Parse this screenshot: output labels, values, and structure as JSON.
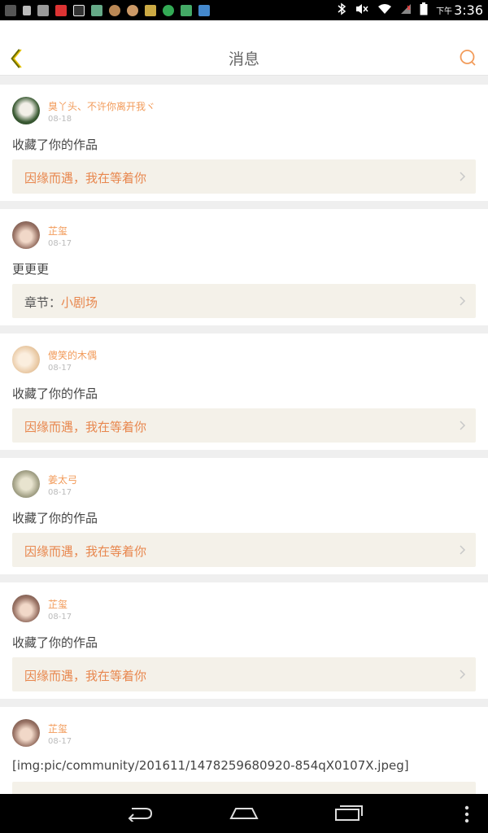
{
  "status_bar": {
    "time_prefix": "下午",
    "time": "3:36"
  },
  "header": {
    "title": "消息"
  },
  "messages": [
    {
      "user": "臭丫头、不许你离开我ヾ",
      "date": "08-18",
      "action": "收藏了你的作品",
      "ref_prefix": "",
      "ref_title": "因缘而遇，我在等着你"
    },
    {
      "user": "芷玺",
      "date": "08-17",
      "action": "更更更",
      "ref_prefix": "章节：",
      "ref_title": "小剧场"
    },
    {
      "user": "傻笑的木偶",
      "date": "08-17",
      "action": "收藏了你的作品",
      "ref_prefix": "",
      "ref_title": "因缘而遇，我在等着你"
    },
    {
      "user": "姜太弓",
      "date": "08-17",
      "action": "收藏了你的作品",
      "ref_prefix": "",
      "ref_title": "因缘而遇，我在等着你"
    },
    {
      "user": "芷玺",
      "date": "08-17",
      "action": "收藏了你的作品",
      "ref_prefix": "",
      "ref_title": "因缘而遇，我在等着你"
    },
    {
      "user": "芷玺",
      "date": "08-17",
      "action": "[img:pic/community/201611/1478259680920-854qX0107X.jpeg]",
      "ref_prefix": "",
      "ref_title": ""
    }
  ],
  "colors": {
    "accent": "#f29b5a",
    "ref_bg": "#f4f1e9"
  }
}
